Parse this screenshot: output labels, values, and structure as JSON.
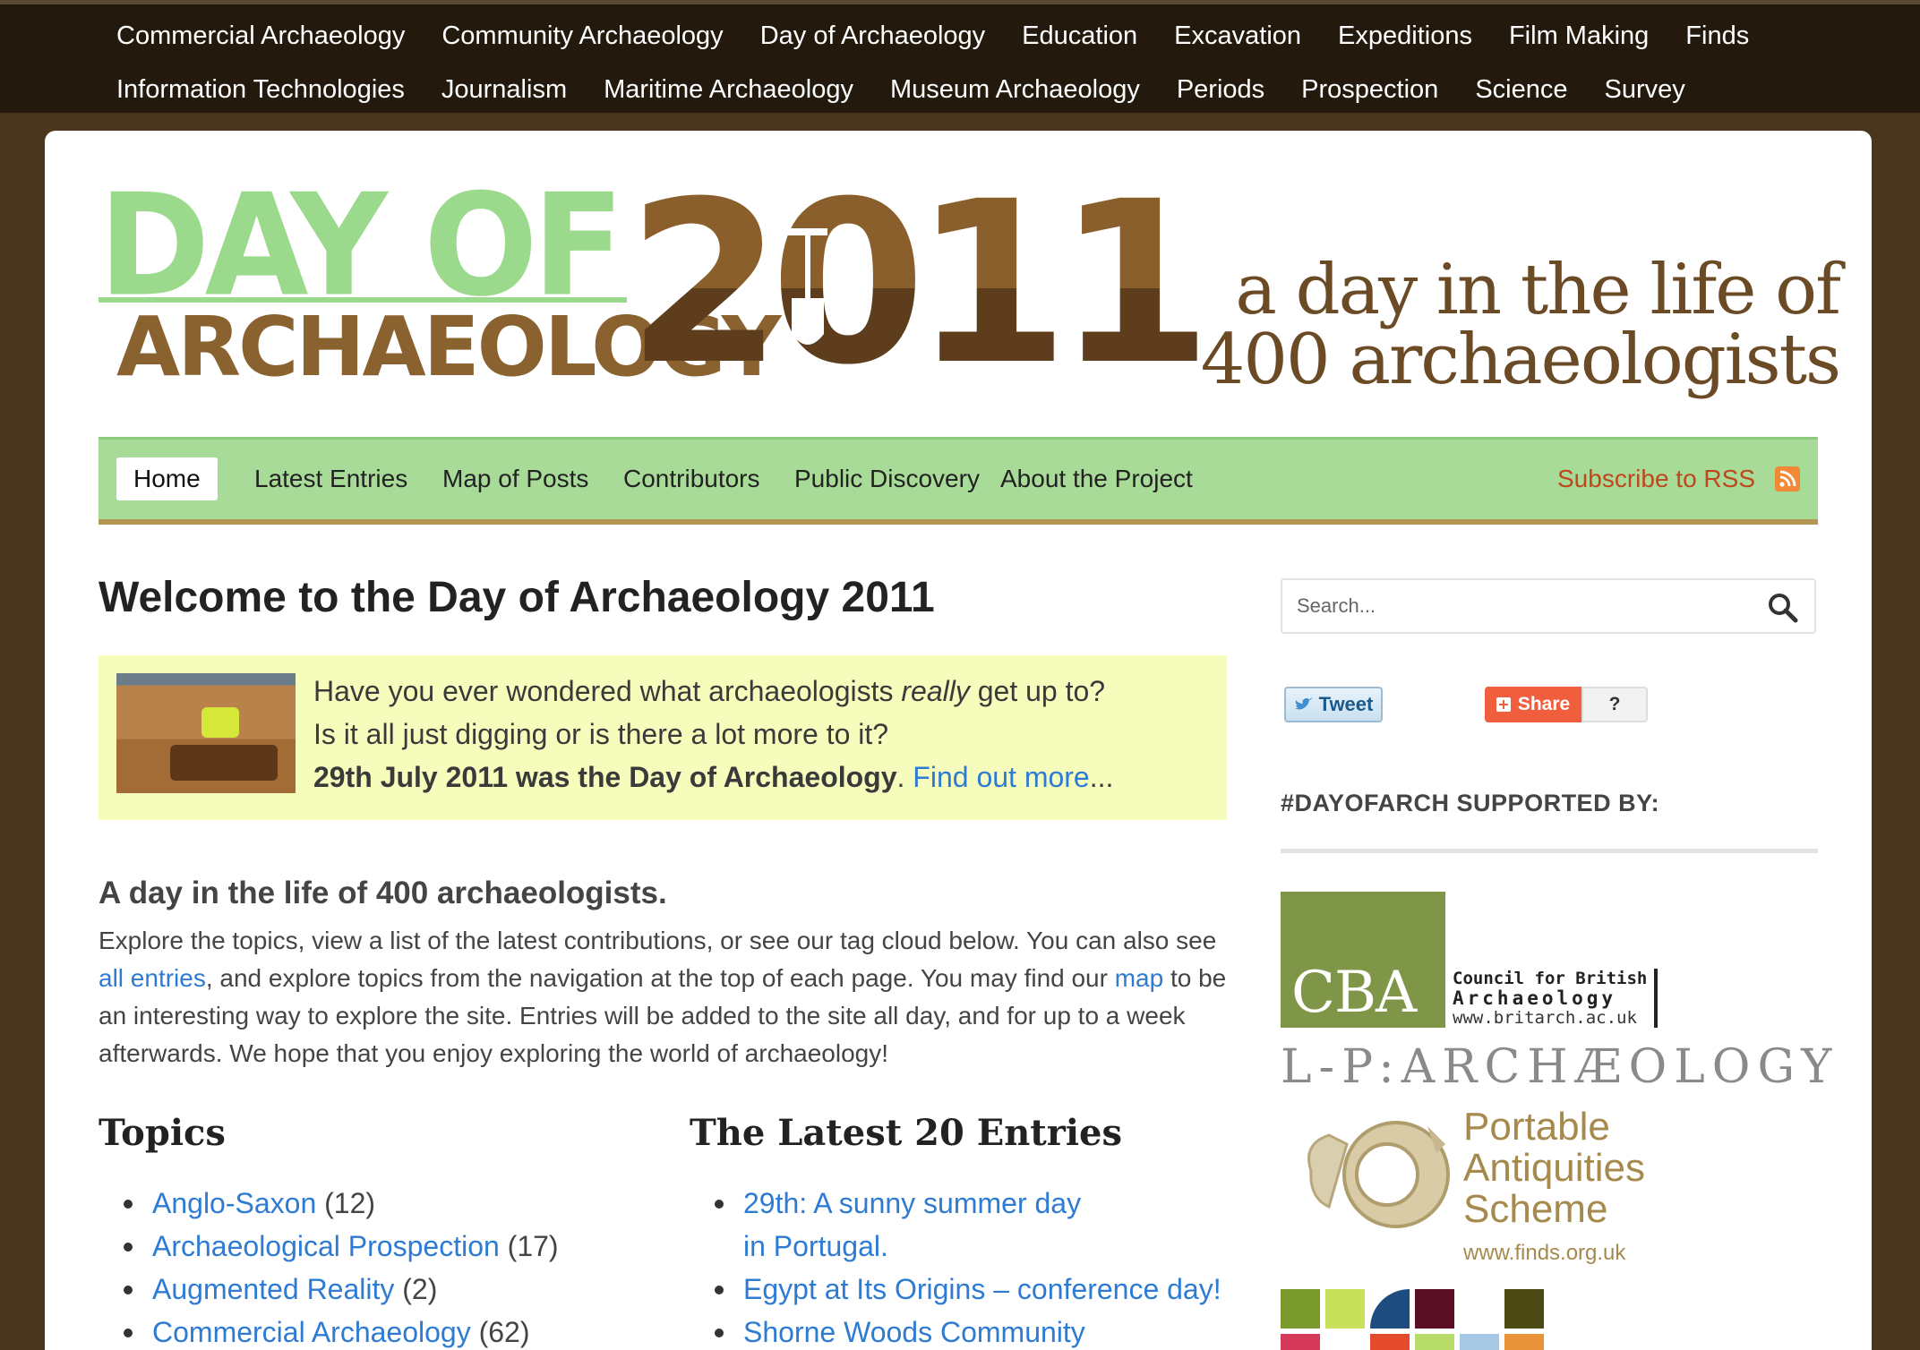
{
  "top_categories": {
    "row1": [
      "Commercial Archaeology",
      "Community Archaeology",
      "Day of Archaeology",
      "Education",
      "Excavation",
      "Expeditions",
      "Film Making",
      "Finds"
    ],
    "row2": [
      "Information Technologies",
      "Journalism",
      "Maritime Archaeology",
      "Museum Archaeology",
      "Periods",
      "Prospection",
      "Science",
      "Survey"
    ]
  },
  "logo": {
    "line1": "DAY OF",
    "line2": "ARCHAEOLOGY",
    "year": "2011"
  },
  "tagline": {
    "line1": "a day in the life of",
    "line2": "400 archaeologists"
  },
  "nav": {
    "items": [
      "Home",
      "Latest Entries",
      "Map of Posts",
      "Contributors",
      "Public Discovery",
      "About the Project"
    ],
    "active": "Home",
    "rss_label": "Subscribe to RSS"
  },
  "main": {
    "title": "Welcome to the Day of Archaeology 2011",
    "intro": {
      "line1_pre": "Have you ever wondered what archaeologists ",
      "line1_em": "really",
      "line1_post": " get up to?",
      "line2": "Is it all just digging or is there a lot more to it?",
      "line3_bold": "29th July 2011 was the Day of Archaeology",
      "line3_sep": ". ",
      "line3_link": "Find out more",
      "line3_end": "..."
    },
    "subhead": "A day in the life of 400 archaeologists.",
    "para": {
      "p1": "Explore the topics, view a list of the latest contributions, or see our tag cloud below. You can also see ",
      "link1": "all entries",
      "p2": ", and explore topics from the navigation at the top of each page. You may find our ",
      "link2": "map",
      "p3": " to be an interesting way to explore the site. Entries will be added to the site all day, and for up to a week afterwards. We hope that you enjoy exploring the world of archaeology!"
    },
    "topics_heading": "Topics",
    "topics": [
      {
        "label": "Anglo-Saxon",
        "count": "(12)"
      },
      {
        "label": "Archaeological Prospection",
        "count": "(17)"
      },
      {
        "label": "Augmented Reality",
        "count": "(2)"
      },
      {
        "label": "Commercial Archaeology",
        "count": "(62)"
      }
    ],
    "latest_heading": "The Latest 20 Entries",
    "latest": [
      "29th: A sunny summer day in Portugal.",
      "Egypt at Its Origins – conference day!",
      "Shorne Woods Community"
    ]
  },
  "sidebar": {
    "search_placeholder": "Search...",
    "tweet_label": "Tweet",
    "share_label": "Share",
    "share_count": "?",
    "supported_heading": "#DAYOFARCH SUPPORTED BY:",
    "cba": {
      "mark": "CBA",
      "line1": "Council for British",
      "line2": "Archaeology",
      "line3": "www.britarch.ac.uk"
    },
    "lp": "L-P:ARCHÆOLOGY",
    "pas": {
      "line1": "Portable",
      "line2": "Antiquities",
      "line3": "Scheme",
      "url": "www.finds.org.uk"
    }
  },
  "colors": {
    "topbar": "#231a0d",
    "page_bg": "#4a361c",
    "nav_green": "#a8db98",
    "link_blue": "#2e7bd4",
    "rss_orange": "#c0461b",
    "intro_bg": "#f6fdbc"
  }
}
